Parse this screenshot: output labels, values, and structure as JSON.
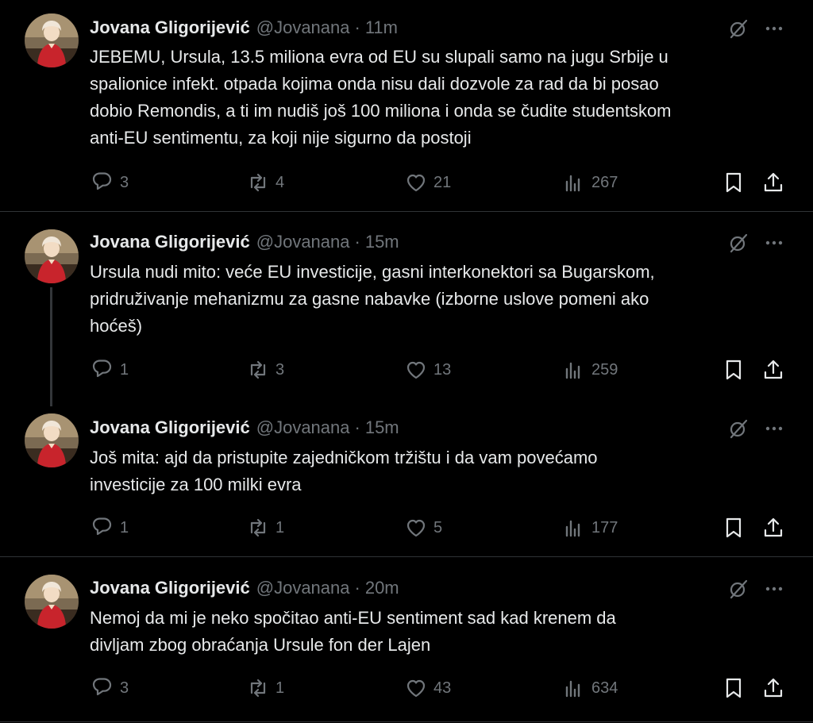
{
  "tweets": [
    {
      "name": "Jovana Gligorijević",
      "handle": "@Jovanana",
      "separator": "·",
      "time": "11m",
      "lines": [
        "JEBEMU, Ursula, 13.5 miliona evra od EU su slupali samo na jugu Srbije u",
        "spalionice infekt. otpada kojima onda nisu dali dozvole za rad da bi posao",
        "dobio Remondis, a ti im nudiš još 100 miliona i onda se čudite studentskom",
        "anti-EU sentimentu, za koji nije sigurno da postoji"
      ],
      "replies": "3",
      "reposts": "4",
      "likes": "21",
      "views": "267"
    },
    {
      "name": "Jovana Gligorijević",
      "handle": "@Jovanana",
      "separator": "·",
      "time": "15m",
      "lines": [
        "Ursula nudi mito: veće EU investicije, gasni interkonektori sa Bugarskom,",
        "pridruživanje mehanizmu za gasne nabavke (izborne uslove pomeni ako",
        "hoćeš)"
      ],
      "replies": "1",
      "reposts": "3",
      "likes": "13",
      "views": "259"
    },
    {
      "name": "Jovana Gligorijević",
      "handle": "@Jovanana",
      "separator": "·",
      "time": "15m",
      "lines": [
        "Još mita: ajd da pristupite zajedničkom tržištu i da vam povećamo",
        "investicije za 100 milki evra"
      ],
      "replies": "1",
      "reposts": "1",
      "likes": "5",
      "views": "177"
    },
    {
      "name": "Jovana Gligorijević",
      "handle": "@Jovanana",
      "separator": "·",
      "time": "20m",
      "lines": [
        "Nemoj da mi je neko spočitao anti-EU sentiment sad kad krenem da",
        "divljam zbog obraćanja Ursule fon der Lajen"
      ],
      "replies": "3",
      "reposts": "1",
      "likes": "43",
      "views": "634"
    }
  ],
  "icons": {
    "reply": "reply-icon",
    "repost": "repost-icon",
    "like": "heart-icon",
    "views": "views-icon",
    "bookmark": "bookmark-icon",
    "share": "share-icon",
    "grok": "grok-icon",
    "more": "more-icon"
  },
  "colors": {
    "background": "#000000",
    "text": "#e7e9ea",
    "muted": "#71767b",
    "divider": "#2f3336",
    "thread_line": "#333639"
  }
}
